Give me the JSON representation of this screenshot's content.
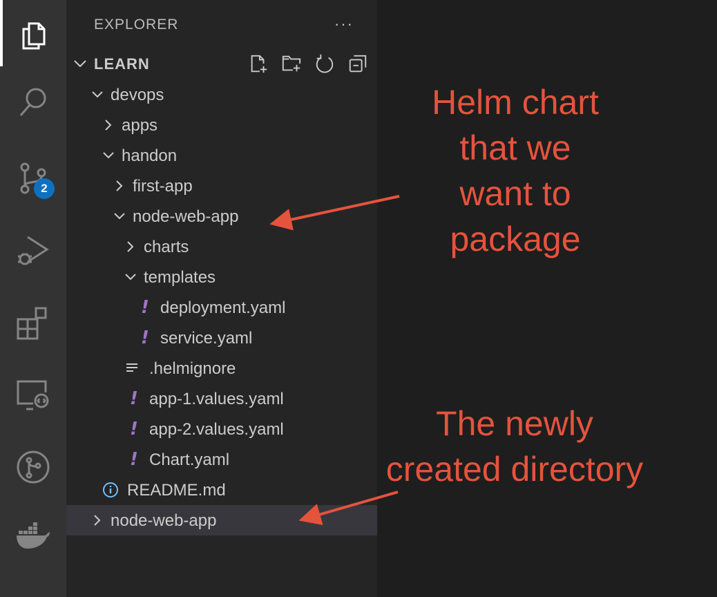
{
  "explorer": {
    "title": "EXPLORER",
    "more_label": "···",
    "section": "LEARN",
    "tree": [
      {
        "label": "devops",
        "depth": 1,
        "kind": "folder",
        "open": true
      },
      {
        "label": "apps",
        "depth": 2,
        "kind": "folder",
        "open": false
      },
      {
        "label": "handon",
        "depth": 2,
        "kind": "folder",
        "open": true
      },
      {
        "label": "first-app",
        "depth": 3,
        "kind": "folder",
        "open": false
      },
      {
        "label": "node-web-app",
        "depth": 3,
        "kind": "folder",
        "open": true
      },
      {
        "label": "charts",
        "depth": 4,
        "kind": "folder",
        "open": false
      },
      {
        "label": "templates",
        "depth": 4,
        "kind": "folder",
        "open": true
      },
      {
        "label": "deployment.yaml",
        "depth": 5,
        "kind": "yaml"
      },
      {
        "label": "service.yaml",
        "depth": 5,
        "kind": "yaml"
      },
      {
        "label": ".helmignore",
        "depth": 4,
        "kind": "text"
      },
      {
        "label": "app-1.values.yaml",
        "depth": 4,
        "kind": "yaml"
      },
      {
        "label": "app-2.values.yaml",
        "depth": 4,
        "kind": "yaml"
      },
      {
        "label": "Chart.yaml",
        "depth": 4,
        "kind": "yaml"
      },
      {
        "label": "README.md",
        "depth": 2,
        "kind": "info"
      },
      {
        "label": "node-web-app",
        "depth": 1,
        "kind": "folder",
        "open": false,
        "selected": true
      }
    ]
  },
  "activity_bar": {
    "items": [
      "explorer-icon",
      "search-icon",
      "source-control-icon",
      "run-debug-icon",
      "extensions-icon",
      "remote-explorer-icon",
      "git-graph-icon",
      "docker-icon"
    ],
    "source_control_badge": "2"
  },
  "annotations": {
    "helm_lines": [
      "Helm chart",
      "that we",
      "want to",
      "package"
    ],
    "newdir_lines": [
      "The newly",
      "created directory"
    ],
    "color": "#e5533d"
  },
  "colors": {
    "activity_bar": "#333333",
    "sidebar": "#252526",
    "editor": "#1e1e1e",
    "selection": "#37373d",
    "badge": "#0e70c0",
    "yaml_icon": "#a074c4",
    "info_icon": "#75beff"
  }
}
